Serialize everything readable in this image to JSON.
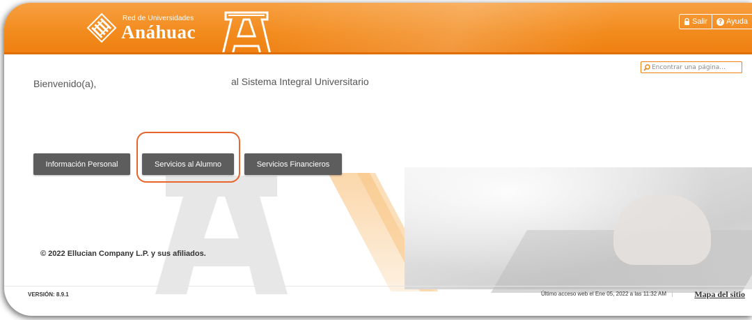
{
  "header": {
    "logo_small": "Red de Universidades",
    "logo_big": "Anáhuac",
    "links": [
      {
        "label": "Salir",
        "icon": "lock-icon"
      },
      {
        "label": "Ayuda",
        "icon": "help-icon"
      }
    ]
  },
  "welcome": {
    "greeting": "Bienvenido(a),",
    "system": "al Sistema Integral Universitario"
  },
  "search": {
    "placeholder": "Encontrar una página..."
  },
  "nav_buttons": [
    {
      "label": "Información Personal"
    },
    {
      "label": "Servicios al Alumno",
      "highlighted": true
    },
    {
      "label": "Servicios Financieros"
    }
  ],
  "footer": {
    "copyright": "© 2022 Ellucian Company L.P. y sus afiliados.",
    "version": "VERSIÓN: 8.9.1",
    "last_access": "Último acceso web el Ene 05, 2022 a las 11:32 AM",
    "sitemap": "Mapa del sitio"
  },
  "colors": {
    "brand_orange": "#ef7f10",
    "button_gray": "#5d5d5d",
    "highlight": "#e8642a"
  }
}
